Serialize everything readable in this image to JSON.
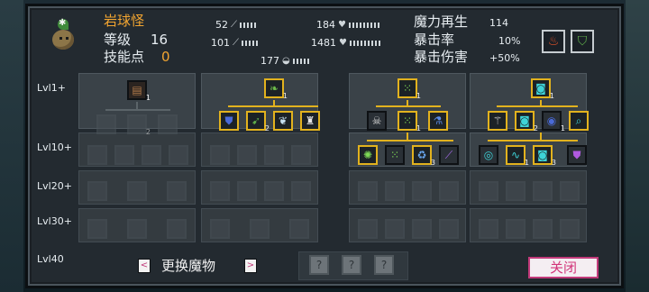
{
  "monster": {
    "name": "岩球怪",
    "level_label": "等级",
    "level": "16",
    "skill_points_label": "技能点",
    "skill_points": "0"
  },
  "stats": {
    "attack": "52",
    "defense": "101",
    "hp": "184",
    "shield": "1481",
    "speed": "177"
  },
  "right_stats": {
    "mana_regen_label": "魔力再生",
    "mana_regen": "114",
    "crit_rate_label": "暴击率",
    "crit_rate": "10%",
    "crit_damage_label": "暴击伤害",
    "crit_damage": "+50%"
  },
  "level_rows": [
    "Lvl1+",
    "Lvl10+",
    "Lvl20+",
    "Lvl30+",
    "Lvl40"
  ],
  "columns": [
    {
      "root_count": "1",
      "tier1": [
        {
          "count": "2"
        }
      ],
      "tier1_ghost_count": "2"
    },
    {
      "root_count": "1",
      "tier1": [
        {
          "count": ""
        },
        {
          "count": "2"
        },
        {
          "count": ""
        },
        {
          "count": ""
        }
      ]
    },
    {
      "root_count": "1",
      "tier1": [
        {
          "count": ""
        },
        {
          "count": "1"
        },
        {
          "count": ""
        }
      ],
      "tier2": [
        {
          "count": ""
        },
        {
          "count": ""
        },
        {
          "count": "3"
        },
        {
          "count": ""
        }
      ]
    },
    {
      "root_count": "1",
      "tier1": [
        {
          "count": ""
        },
        {
          "count": "2"
        },
        {
          "count": "1"
        },
        {
          "count": ""
        }
      ],
      "tier2": [
        {
          "count": ""
        },
        {
          "count": "1"
        },
        {
          "count": "3"
        },
        {
          "count": ""
        }
      ]
    }
  ],
  "footer": {
    "switch_label": "更换魔物",
    "prev": "<",
    "next": ">",
    "q1": "?",
    "q2": "?",
    "q3": "?",
    "close_label": "关闭"
  },
  "colors": {
    "accent_gold": "#e2b21e",
    "name_orange": "#f2a531",
    "close_pink": "#c23a7a"
  }
}
